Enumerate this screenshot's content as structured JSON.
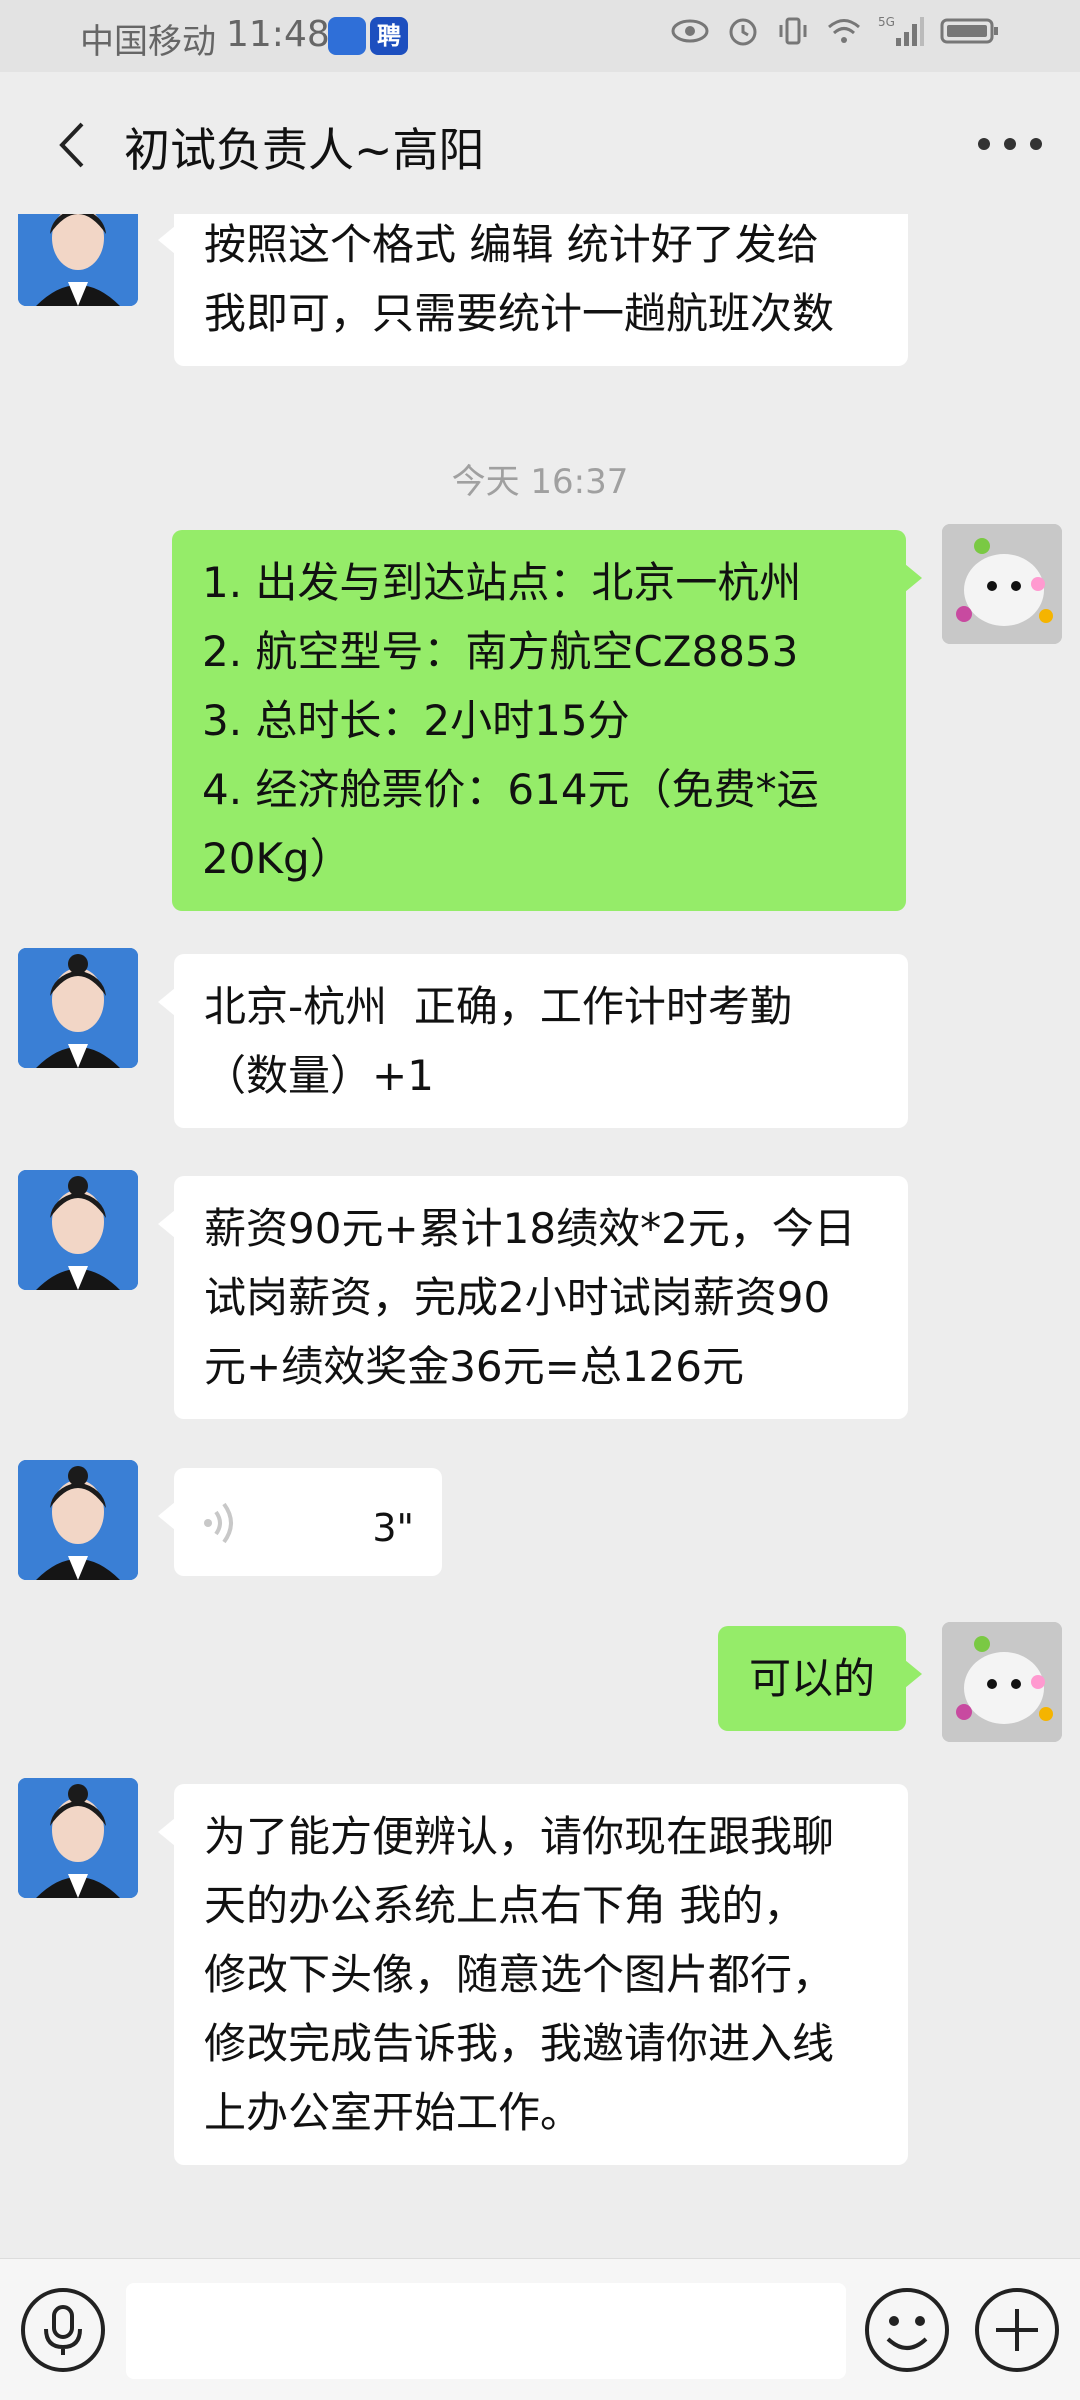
{
  "status_bar": {
    "carrier": "中国移动",
    "time": "11:48",
    "app_badge_text": "聘",
    "network": "5G"
  },
  "header": {
    "title": "初试负责人~高阳"
  },
  "messages": [
    {
      "sender": "other",
      "type": "text",
      "text": "按照这个格式 编辑 统计好了发给\n我即可，只需要统计一趟航班次数"
    },
    {
      "type": "timestamp",
      "text": "今天 16:37"
    },
    {
      "sender": "me",
      "type": "text",
      "text": "1. 出发与到达站点：北京一杭州\n2. 航空型号：南方航空CZ8853\n3. 总时长：2小时15分\n4. 经济舱票价：614元（免费*运\n20Kg）"
    },
    {
      "sender": "other",
      "type": "text",
      "text": "北京-杭州  正确，工作计时考勤\n（数量）+1"
    },
    {
      "sender": "other",
      "type": "text",
      "text": "薪资90元+累计18绩效*2元，今日\n试岗薪资，完成2小时试岗薪资90\n元+绩效奖金36元=总126元"
    },
    {
      "sender": "other",
      "type": "voice",
      "duration": "3\""
    },
    {
      "sender": "me",
      "type": "text",
      "text": "可以的"
    },
    {
      "sender": "other",
      "type": "text",
      "text": "为了能方便辨认，请你现在跟我聊\n天的办公系统上点右下角 我的，\n修改下头像，随意选个图片都行，\n修改完成告诉我，我邀请你进入线\n上办公室开始工作。"
    }
  ],
  "input_bar": {
    "placeholder": "",
    "icons": [
      "voice-icon",
      "emoji-icon",
      "plus-icon"
    ]
  },
  "colors": {
    "background": "#ededed",
    "my_bubble": "#95ec69",
    "other_bubble": "#ffffff",
    "timestamp_text": "#a0a0a0"
  }
}
